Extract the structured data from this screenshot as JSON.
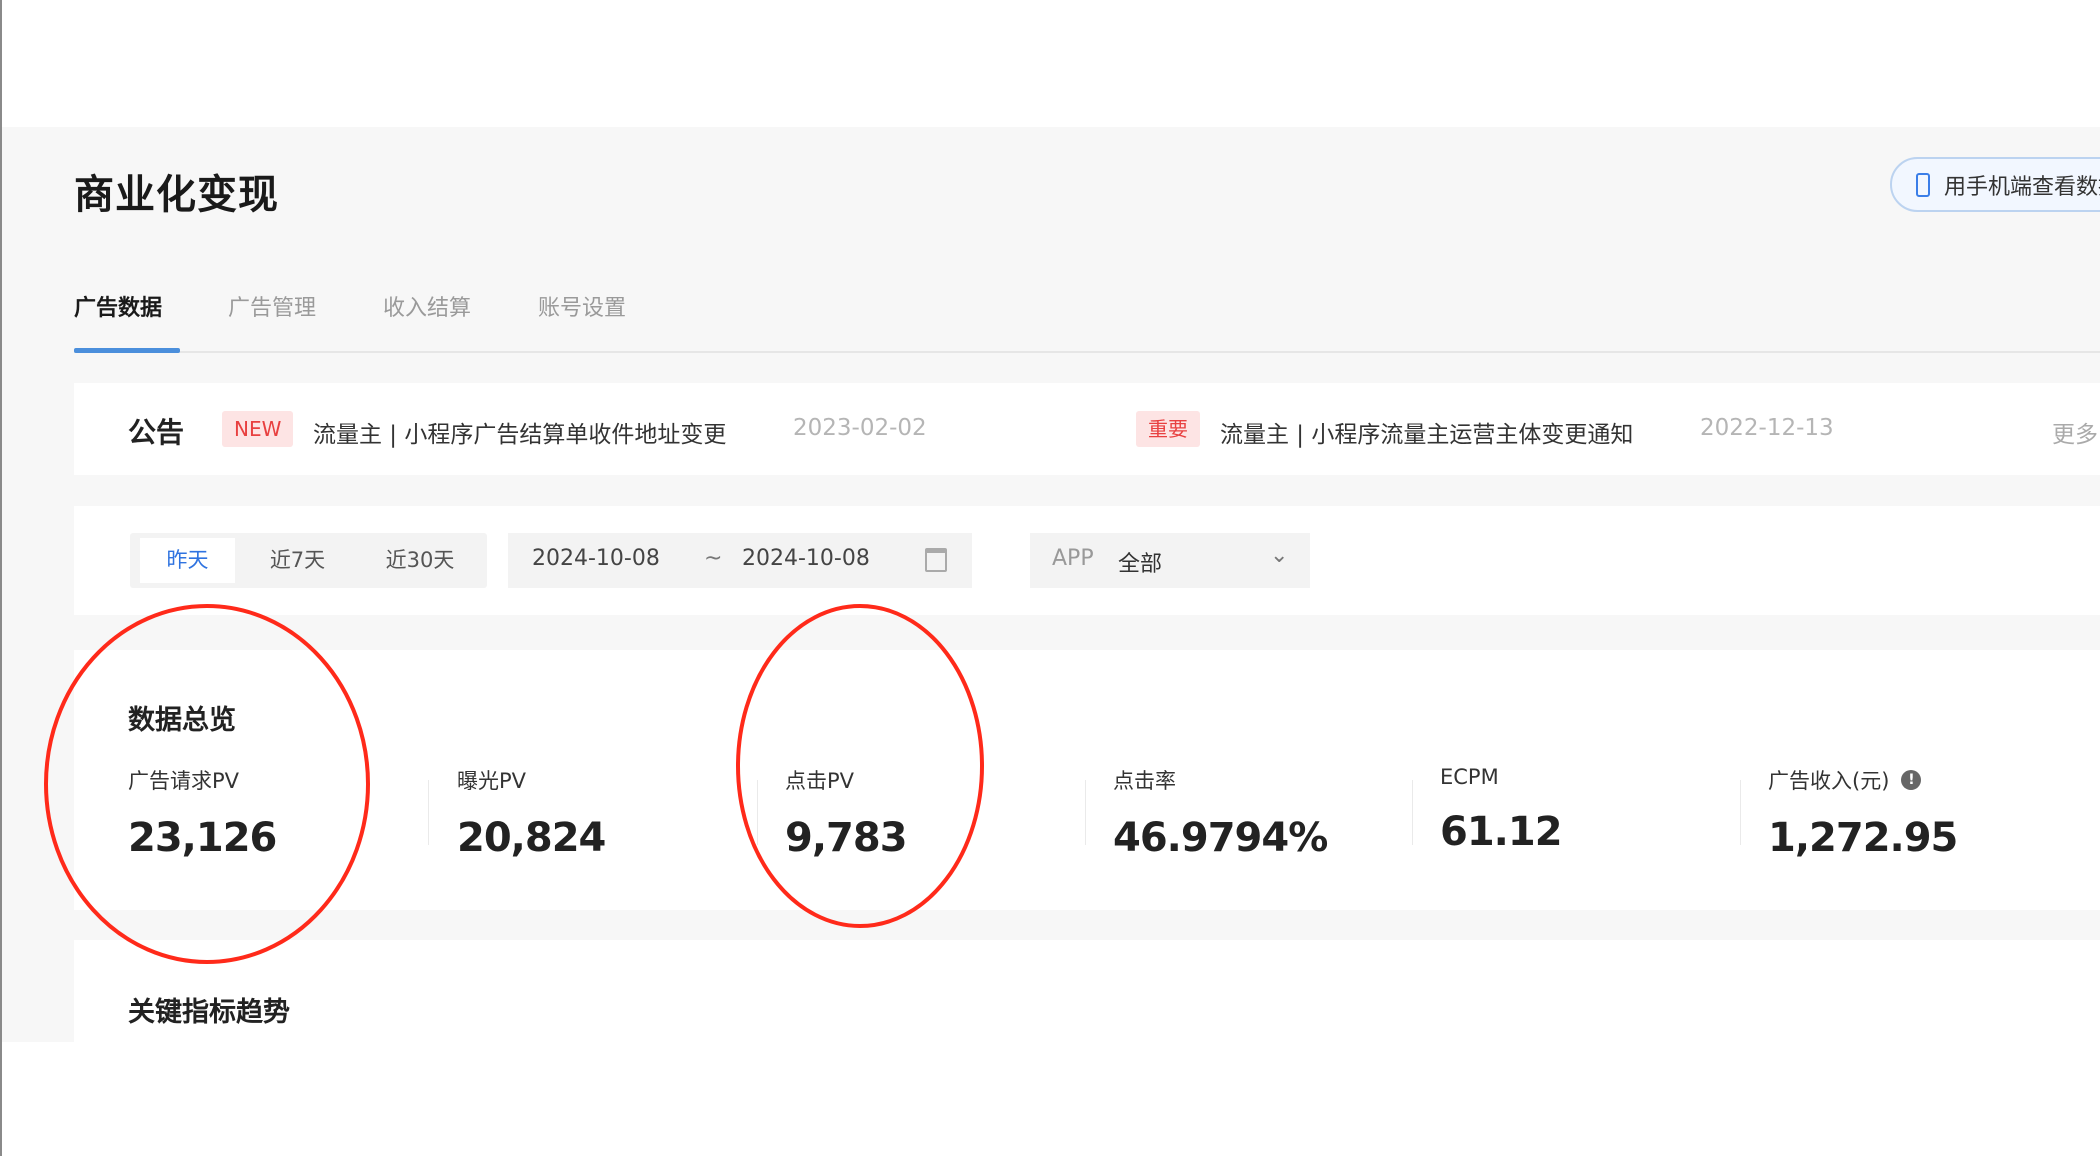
{
  "header": {
    "title": "商业化变现",
    "mobile_button": "用手机端查看数据"
  },
  "tabs": [
    {
      "label": "广告数据",
      "active": true
    },
    {
      "label": "广告管理"
    },
    {
      "label": "收入结算"
    },
    {
      "label": "账号设置"
    }
  ],
  "announcement": {
    "label": "公告",
    "items": [
      {
        "badge": "NEW",
        "text": "流量主 | 小程序广告结算单收件地址变更",
        "date": "2023-02-02"
      },
      {
        "badge": "重要",
        "text": "流量主 | 小程序流量主运营主体变更通知",
        "date": "2022-12-13"
      }
    ],
    "more": "更多"
  },
  "filter": {
    "ranges": [
      "昨天",
      "近7天",
      "近30天"
    ],
    "selected_range": "昨天",
    "start_date": "2024-10-08",
    "separator": "~",
    "end_date": "2024-10-08",
    "app_label": "APP",
    "app_value": "全部"
  },
  "overview": {
    "title": "数据总览",
    "metrics": [
      {
        "label": "广告请求PV",
        "value": "23,126"
      },
      {
        "label": "曝光PV",
        "value": "20,824"
      },
      {
        "label": "点击PV",
        "value": "9,783"
      },
      {
        "label": "点击率",
        "value": "46.9794%"
      },
      {
        "label": "ECPM",
        "value": "61.12"
      },
      {
        "label": "广告收入(元)",
        "value": "1,272.95",
        "info": "!"
      }
    ]
  },
  "trend": {
    "title": "关键指标趋势"
  },
  "annotation_color": "#ff2a1a",
  "accent": "#2f73e0"
}
